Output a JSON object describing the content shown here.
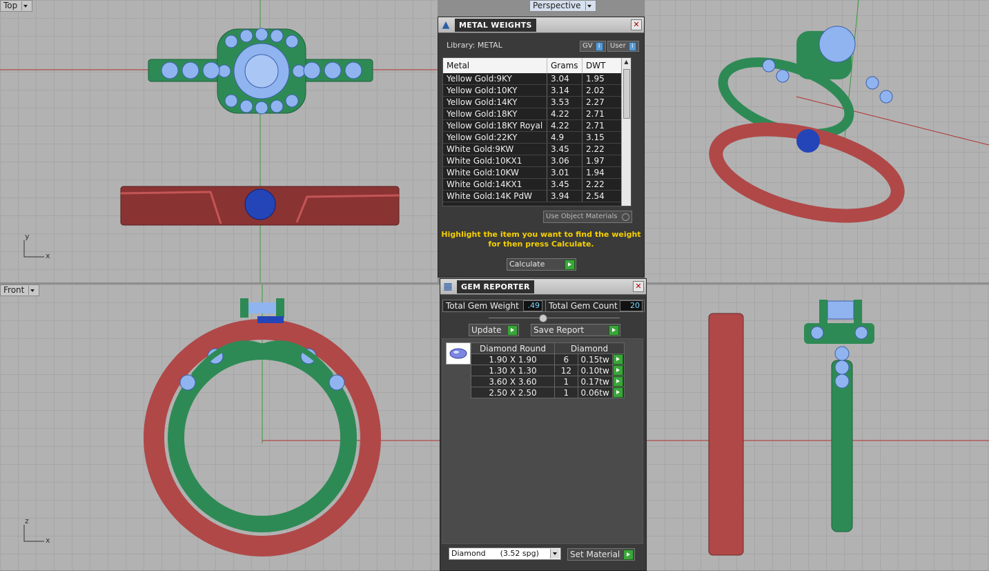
{
  "viewports": {
    "top_label": "Top",
    "perspective_label": "Perspective",
    "front_label": "Front",
    "axis_y": "y",
    "axis_x": "x",
    "axis_z": "z"
  },
  "metal_weights": {
    "title": "METAL WEIGHTS",
    "library_label": "Library: METAL",
    "gv_label": "GV",
    "user_label": "User",
    "columns": [
      "Metal",
      "Grams",
      "DWT"
    ],
    "rows": [
      [
        "Yellow Gold:9KY",
        "3.04",
        "1.95"
      ],
      [
        "Yellow Gold:10KY",
        "3.14",
        "2.02"
      ],
      [
        "Yellow Gold:14KY",
        "3.53",
        "2.27"
      ],
      [
        "Yellow Gold:18KY",
        "4.22",
        "2.71"
      ],
      [
        "Yellow Gold:18KY Royal",
        "4.22",
        "2.71"
      ],
      [
        "Yellow Gold:22KY",
        "4.9",
        "3.15"
      ],
      [
        "White Gold:9KW",
        "3.45",
        "2.22"
      ],
      [
        "White Gold:10KX1",
        "3.06",
        "1.97"
      ],
      [
        "White Gold:10KW",
        "3.01",
        "1.94"
      ],
      [
        "White Gold:14KX1",
        "3.45",
        "2.22"
      ],
      [
        "White Gold:14K PdW",
        "3.94",
        "2.54"
      ]
    ],
    "use_object_materials": "Use Object Materials",
    "hint": "Highlight the item you want to find the weight for then press Calculate.",
    "calculate": "Calculate"
  },
  "gem_reporter": {
    "title": "GEM REPORTER",
    "total_weight_label": "Total Gem Weight",
    "total_weight_value": ".49",
    "total_count_label": "Total Gem Count",
    "total_count_value": "20",
    "update": "Update",
    "save_report": "Save Report",
    "table_header_shape": "Diamond Round",
    "table_header_type": "Diamond",
    "rows": [
      [
        "1.90 X 1.90",
        "6",
        "0.15tw"
      ],
      [
        "1.30 X 1.30",
        "12",
        "0.10tw"
      ],
      [
        "3.60 X 3.60",
        "1",
        "0.17tw"
      ],
      [
        "2.50 X 2.50",
        "1",
        "0.06tw"
      ]
    ],
    "material_select": "Diamond      (3.52 spg)",
    "set_material": "Set Material"
  },
  "colors": {
    "viewport_bg": "#b2b2b2",
    "panel_bg": "#3a3a3a",
    "hint_yellow": "#f5d000",
    "ring_red": "#b04848",
    "ring_green": "#2e8a55",
    "gem_blue": "#8fb4f0",
    "go_green": "#3aa63a"
  }
}
